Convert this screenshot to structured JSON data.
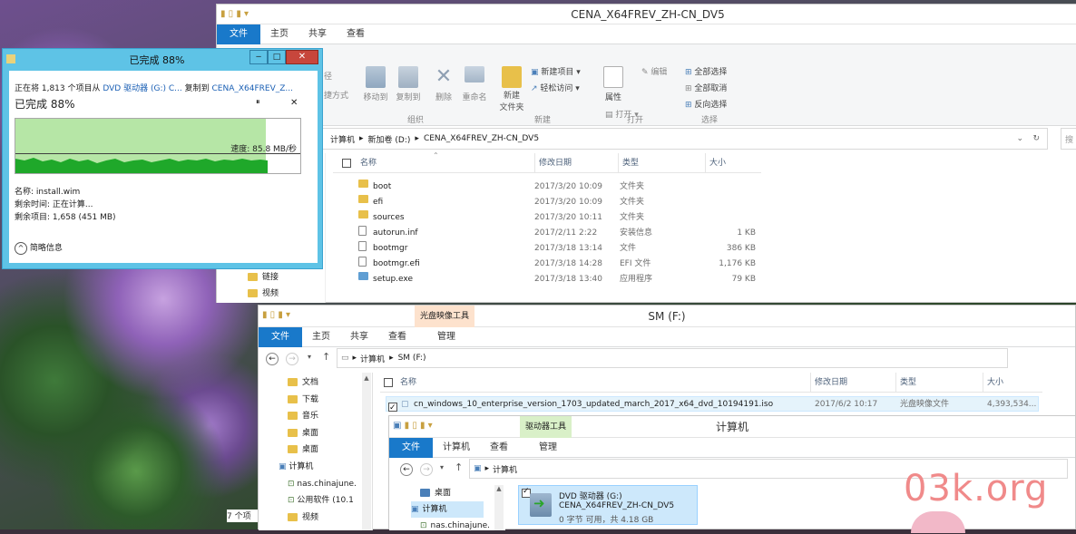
{
  "explorer1": {
    "title": "CENA_X64FREV_ZH-CN_DV5",
    "tabs": [
      "文件",
      "主页",
      "共享",
      "查看"
    ],
    "ribbon": {
      "move_to": "移动到",
      "copy_to": "复制到",
      "delete": "删除",
      "rename": "重命名",
      "new_folder": "新建\n文件夹",
      "new_item": "新建项目",
      "easy_access": "轻松访问",
      "properties": "属性",
      "open": "打开",
      "edit": "编辑",
      "select_all": "全部选择",
      "select_none": "全部取消",
      "invert": "反向选择",
      "partial_left_top": "径",
      "partial_left_bottom": "捷方式",
      "groups": [
        "组织",
        "新建",
        "打开",
        "选择"
      ]
    },
    "breadcrumb": [
      "计算机",
      "新加卷 (D:)",
      "CENA_X64FREV_ZH-CN_DV5"
    ],
    "search_partial": "搜",
    "columns": [
      "名称",
      "修改日期",
      "类型",
      "大小"
    ],
    "files": [
      {
        "name": "boot",
        "date": "2017/3/20 10:09",
        "type": "文件夹",
        "size": "",
        "icon": "folder"
      },
      {
        "name": "efi",
        "date": "2017/3/20 10:09",
        "type": "文件夹",
        "size": "",
        "icon": "folder"
      },
      {
        "name": "sources",
        "date": "2017/3/20 10:11",
        "type": "文件夹",
        "size": "",
        "icon": "folder"
      },
      {
        "name": "autorun.inf",
        "date": "2017/2/11 2:22",
        "type": "安装信息",
        "size": "1 KB",
        "icon": "inf"
      },
      {
        "name": "bootmgr",
        "date": "2017/3/18 13:14",
        "type": "文件",
        "size": "386 KB",
        "icon": "file"
      },
      {
        "name": "bootmgr.efi",
        "date": "2017/3/18 14:28",
        "type": "EFI 文件",
        "size": "1,176 KB",
        "icon": "file"
      },
      {
        "name": "setup.exe",
        "date": "2017/3/18 13:40",
        "type": "应用程序",
        "size": "79 KB",
        "icon": "exe"
      }
    ],
    "nav_items": [
      "链接",
      "视频"
    ],
    "status_partial": "7 个项"
  },
  "copy_dialog": {
    "title": "已完成 88%",
    "line_prefix": "正在将 1,813 个项目从",
    "source": "DVD 驱动器 (G:) C...",
    "copy_to": "复制到",
    "dest": "CENA_X64FREV_Z...",
    "progress_label": "已完成 88%",
    "progress": 0.88,
    "speed": "速度: 85.8 MB/秒",
    "name_line": "名称: install.wim",
    "time_line": "剩余时间: 正在计算...",
    "items_line": "剩余项目: 1,658 (451 MB)",
    "less_details": "简略信息",
    "pause": "⏸",
    "cancel": "✕"
  },
  "explorer2": {
    "title": "SM (F:)",
    "context_tab": "光盘映像工具",
    "tabs": [
      "文件",
      "主页",
      "共享",
      "查看",
      "管理"
    ],
    "breadcrumb": [
      "计算机",
      "SM (F:)"
    ],
    "columns": [
      "名称",
      "修改日期",
      "类型",
      "大小"
    ],
    "files": [
      {
        "name": "cn_windows_10_enterprise_version_1703_updated_march_2017_x64_dvd_10194191.iso",
        "date": "2017/6/2 10:17",
        "type": "光盘映像文件",
        "size": "4,393,534..."
      }
    ],
    "nav": [
      "文档",
      "下载",
      "音乐",
      "桌面",
      "桌面",
      "计算机",
      "nas.chinajune.",
      "公用软件 (10.1",
      "视频"
    ]
  },
  "explorer3": {
    "title": "计算机",
    "context_tab": "驱动器工具",
    "tabs": [
      "文件",
      "计算机",
      "查看",
      "管理"
    ],
    "breadcrumb": [
      "计算机"
    ],
    "nav": [
      "桌面",
      "计算机",
      "nas.chinajune."
    ],
    "drive": {
      "name": "DVD 驱动器 (G:)",
      "label": "CENA_X64FREV_ZH-CN_DV5",
      "space": "0 字节 可用，共 4.18 GB"
    }
  },
  "watermark": "03k.org"
}
